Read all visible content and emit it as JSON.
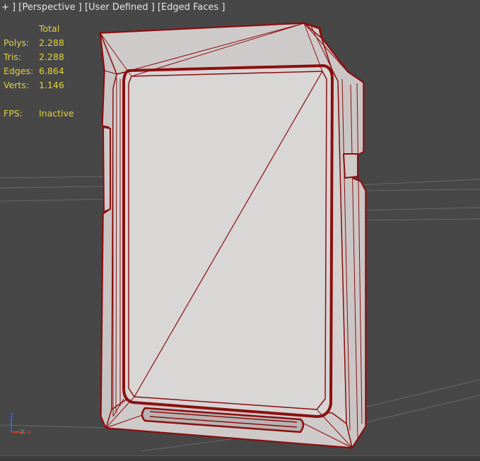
{
  "viewport": {
    "plus_menu": "+ ]",
    "view_menu": "[Perspective ]",
    "shading_menu": "[User Defined ]",
    "edged_menu": "[Edged Faces ]"
  },
  "stats": {
    "header": "Total",
    "polys_label": "Polys:",
    "polys_value": "2.288",
    "tris_label": "Tris:",
    "tris_value": "2.288",
    "edges_label": "Edges:",
    "edges_value": "6.864",
    "verts_label": "Verts:",
    "verts_value": "1.146",
    "fps_label": "FPS:",
    "fps_value": "Inactive"
  },
  "axis": {
    "z": "z",
    "y": "y",
    "x": "x"
  },
  "colors": {
    "viewport_bg": "#474747",
    "grid": "#6a6a6a",
    "mesh_face": "#d6d3d3",
    "mesh_edge": "#8a0f0f",
    "stats_text": "#e2d23c",
    "axis_x": "#d43a3a",
    "axis_y": "#37b84a",
    "axis_z": "#3a6fd8"
  }
}
